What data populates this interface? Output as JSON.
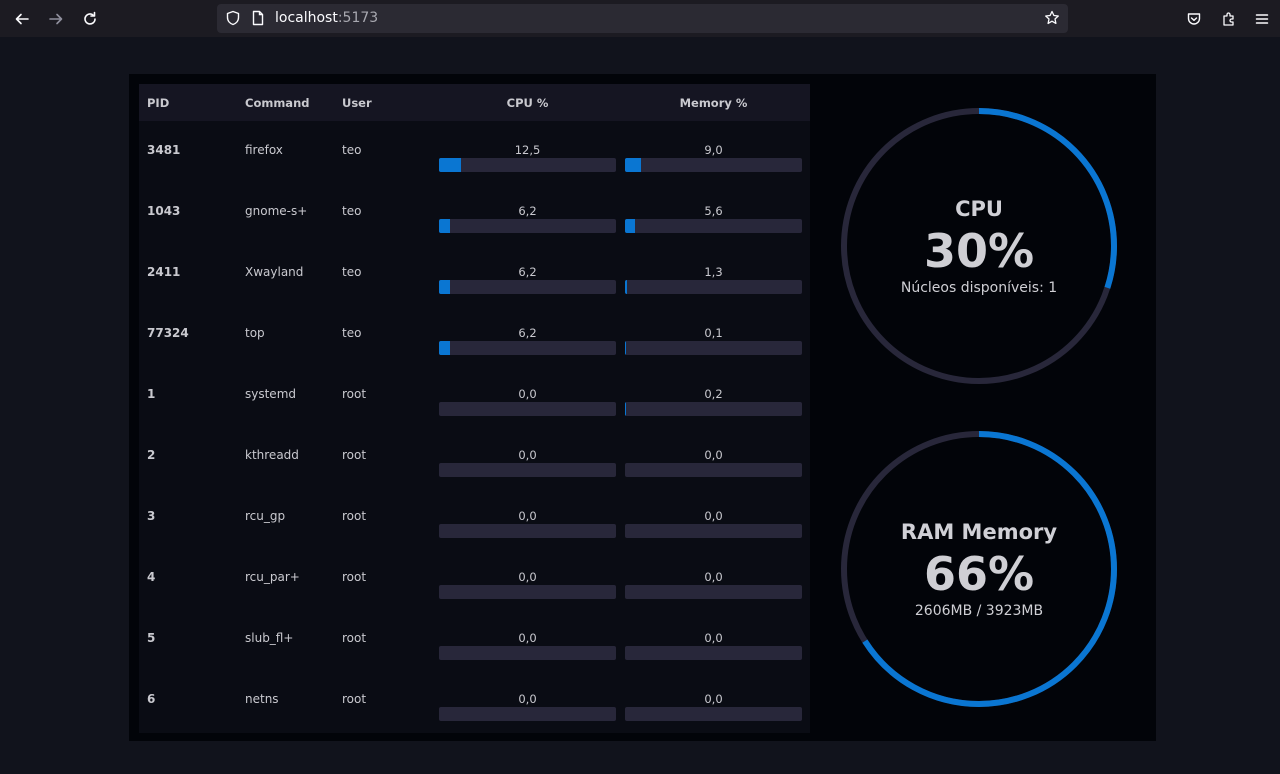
{
  "browser": {
    "url_host": "localhost",
    "url_port": ":5173"
  },
  "table": {
    "headers": {
      "pid": "PID",
      "command": "Command",
      "user": "User",
      "cpu": "CPU %",
      "mem": "Memory %"
    },
    "rows": [
      {
        "pid": "3481",
        "command": "firefox",
        "user": "teo",
        "cpu": "12,5",
        "mem": "9,0",
        "cpu_pct": 12.5,
        "mem_pct": 9.0
      },
      {
        "pid": "1043",
        "command": "gnome-s+",
        "user": "teo",
        "cpu": "6,2",
        "mem": "5,6",
        "cpu_pct": 6.2,
        "mem_pct": 5.6
      },
      {
        "pid": "2411",
        "command": "Xwayland",
        "user": "teo",
        "cpu": "6,2",
        "mem": "1,3",
        "cpu_pct": 6.2,
        "mem_pct": 1.3
      },
      {
        "pid": "77324",
        "command": "top",
        "user": "teo",
        "cpu": "6,2",
        "mem": "0,1",
        "cpu_pct": 6.2,
        "mem_pct": 0.1
      },
      {
        "pid": "1",
        "command": "systemd",
        "user": "root",
        "cpu": "0,0",
        "mem": "0,2",
        "cpu_pct": 0.0,
        "mem_pct": 0.2
      },
      {
        "pid": "2",
        "command": "kthreadd",
        "user": "root",
        "cpu": "0,0",
        "mem": "0,0",
        "cpu_pct": 0.0,
        "mem_pct": 0.0
      },
      {
        "pid": "3",
        "command": "rcu_gp",
        "user": "root",
        "cpu": "0,0",
        "mem": "0,0",
        "cpu_pct": 0.0,
        "mem_pct": 0.0
      },
      {
        "pid": "4",
        "command": "rcu_par+",
        "user": "root",
        "cpu": "0,0",
        "mem": "0,0",
        "cpu_pct": 0.0,
        "mem_pct": 0.0
      },
      {
        "pid": "5",
        "command": "slub_fl+",
        "user": "root",
        "cpu": "0,0",
        "mem": "0,0",
        "cpu_pct": 0.0,
        "mem_pct": 0.0
      },
      {
        "pid": "6",
        "command": "netns",
        "user": "root",
        "cpu": "0,0",
        "mem": "0,0",
        "cpu_pct": 0.0,
        "mem_pct": 0.0
      }
    ]
  },
  "cpu_gauge": {
    "title": "CPU",
    "value": "30%",
    "fraction": 0.3,
    "subtitle": "Núcleos disponíveis: 1"
  },
  "ram_gauge": {
    "title": "RAM Memory",
    "value": "66%",
    "fraction": 0.66,
    "subtitle": "2606MB / 3923MB"
  },
  "colors": {
    "accent": "#0a76d2",
    "track": "#28273a"
  }
}
